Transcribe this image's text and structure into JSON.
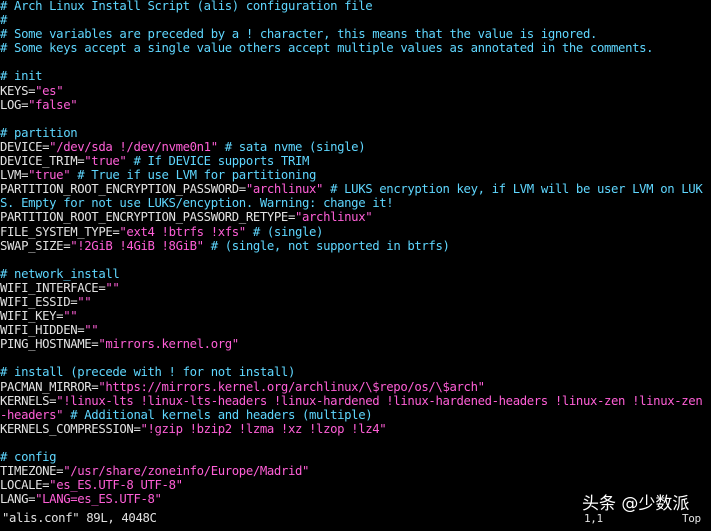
{
  "colors": {
    "background": "#000000",
    "comment": "#5fd7ff",
    "key": "#e2e2e2",
    "string": "#ff5fd7",
    "text": "#e2e2e2"
  },
  "lines": [
    [
      {
        "c": "c",
        "t": "# Arch Linux Install Script (alis) configuration file"
      }
    ],
    [
      {
        "c": "c",
        "t": "#"
      }
    ],
    [
      {
        "c": "c",
        "t": "# Some variables are preceded by a ! character, this means that the value is ignored."
      }
    ],
    [
      {
        "c": "c",
        "t": "# Some keys accept a single value others accept multiple values as annotated in the comments."
      }
    ],
    [],
    [
      {
        "c": "c",
        "t": "# init"
      }
    ],
    [
      {
        "c": "k",
        "t": "KEYS="
      },
      {
        "c": "s",
        "t": "\"es\""
      }
    ],
    [
      {
        "c": "k",
        "t": "LOG="
      },
      {
        "c": "s",
        "t": "\"false\""
      }
    ],
    [],
    [
      {
        "c": "c",
        "t": "# partition"
      }
    ],
    [
      {
        "c": "k",
        "t": "DEVICE="
      },
      {
        "c": "s",
        "t": "\"/dev/sda !/dev/nvme0n1\""
      },
      {
        "c": "c",
        "t": " # sata nvme (single)"
      }
    ],
    [
      {
        "c": "k",
        "t": "DEVICE_TRIM="
      },
      {
        "c": "s",
        "t": "\"true\""
      },
      {
        "c": "c",
        "t": " # If DEVICE supports TRIM"
      }
    ],
    [
      {
        "c": "k",
        "t": "LVM="
      },
      {
        "c": "s",
        "t": "\"true\""
      },
      {
        "c": "c",
        "t": " # True if use LVM for partitioning"
      }
    ],
    [
      {
        "c": "k",
        "t": "PARTITION_ROOT_ENCRYPTION_PASSWORD="
      },
      {
        "c": "s",
        "t": "\"archlinux\""
      },
      {
        "c": "c",
        "t": " # LUKS encryption key, if LVM will be user LVM on LUK"
      }
    ],
    [
      {
        "c": "c",
        "t": "S. Empty for not use LUKS/encyption. Warning: change it!"
      }
    ],
    [
      {
        "c": "k",
        "t": "PARTITION_ROOT_ENCRYPTION_PASSWORD_RETYPE="
      },
      {
        "c": "s",
        "t": "\"archlinux\""
      }
    ],
    [
      {
        "c": "k",
        "t": "FILE_SYSTEM_TYPE="
      },
      {
        "c": "s",
        "t": "\"ext4 !btrfs !xfs\""
      },
      {
        "c": "c",
        "t": " # (single)"
      }
    ],
    [
      {
        "c": "k",
        "t": "SWAP_SIZE="
      },
      {
        "c": "s",
        "t": "\"!2GiB !4GiB !8GiB\""
      },
      {
        "c": "c",
        "t": " # (single, not supported in btrfs)"
      }
    ],
    [],
    [
      {
        "c": "c",
        "t": "# network_install"
      }
    ],
    [
      {
        "c": "k",
        "t": "WIFI_INTERFACE="
      },
      {
        "c": "s",
        "t": "\"\""
      }
    ],
    [
      {
        "c": "k",
        "t": "WIFI_ESSID="
      },
      {
        "c": "s",
        "t": "\"\""
      }
    ],
    [
      {
        "c": "k",
        "t": "WIFI_KEY="
      },
      {
        "c": "s",
        "t": "\"\""
      }
    ],
    [
      {
        "c": "k",
        "t": "WIFI_HIDDEN="
      },
      {
        "c": "s",
        "t": "\"\""
      }
    ],
    [
      {
        "c": "k",
        "t": "PING_HOSTNAME="
      },
      {
        "c": "s",
        "t": "\"mirrors.kernel.org\""
      }
    ],
    [],
    [
      {
        "c": "c",
        "t": "# install (precede with ! for not install)"
      }
    ],
    [
      {
        "c": "k",
        "t": "PACMAN_MIRROR="
      },
      {
        "c": "s",
        "t": "\"https://mirrors.kernel.org/archlinux/\\$repo/os/\\$arch\""
      }
    ],
    [
      {
        "c": "k",
        "t": "KERNELS="
      },
      {
        "c": "s",
        "t": "\"!linux-lts !linux-lts-headers !linux-hardened !linux-hardened-headers !linux-zen !linux-zen"
      }
    ],
    [
      {
        "c": "s",
        "t": "-headers\""
      },
      {
        "c": "c",
        "t": " # Additional kernels and headers (multiple)"
      }
    ],
    [
      {
        "c": "k",
        "t": "KERNELS_COMPRESSION="
      },
      {
        "c": "s",
        "t": "\"!gzip !bzip2 !lzma !xz !lzop !lz4\""
      }
    ],
    [],
    [
      {
        "c": "c",
        "t": "# config"
      }
    ],
    [
      {
        "c": "k",
        "t": "TIMEZONE="
      },
      {
        "c": "s",
        "t": "\"/usr/share/zoneinfo/Europe/Madrid\""
      }
    ],
    [
      {
        "c": "k",
        "t": "LOCALE="
      },
      {
        "c": "s",
        "t": "\"es_ES.UTF-8 UTF-8\""
      }
    ],
    [
      {
        "c": "k",
        "t": "LANG="
      },
      {
        "c": "s",
        "t": "\"LANG=es_ES.UTF-8\""
      }
    ]
  ],
  "status": {
    "file": "\"alis.conf\" 89L, 4048C",
    "position": "1,1",
    "scroll": "Top"
  },
  "watermark": "头条 @少数派"
}
